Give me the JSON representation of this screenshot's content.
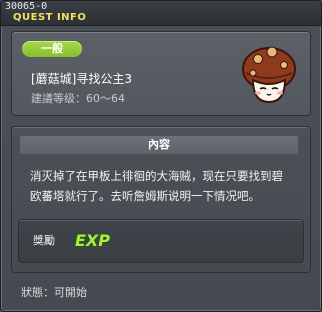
{
  "window": {
    "quest_id": "30065-0",
    "title": "QUEST INFO"
  },
  "quest": {
    "category": "一般",
    "name": "[蘑菇城]寻找公主3",
    "level_label": "建議等级：",
    "level_range": "60～64"
  },
  "content": {
    "header": "內容",
    "description": "消灭掉了在甲板上徘徊的大海贼，现在只要找到碧欧蕃塔就行了。去听詹姆斯说明一下情况吧。"
  },
  "reward": {
    "label": "獎勵",
    "icon": "exp-icon",
    "icon_text": "EXP"
  },
  "status": {
    "label": "狀態：",
    "value": "可開始"
  },
  "colors": {
    "accent": "#f2e35a",
    "badge_green": "#95c93a",
    "exp_green": "#a6ee45"
  }
}
